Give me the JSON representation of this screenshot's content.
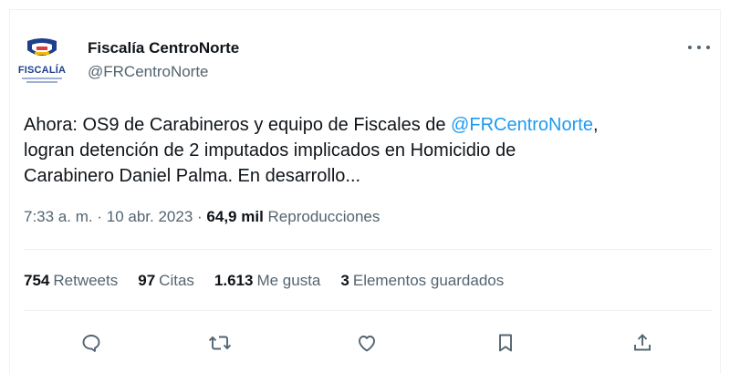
{
  "tweet": {
    "display_name": "Fiscalía CentroNorte",
    "handle": "@FRCentroNorte",
    "avatar_label": "FISCALÍA",
    "text_before": "Ahora: OS9 de Carabineros y equipo de Fiscales de ",
    "mention": "@FRCentroNorte",
    "text_after": ",",
    "text_line2": "logran detención de 2 imputados implicados en Homicidio de",
    "text_line3": "Carabinero Daniel Palma. En desarrollo...",
    "time": "7:33 a. m.",
    "sep1": "·",
    "date": "10 abr. 2023",
    "sep2": "·",
    "views_count": "64,9 mil",
    "views_label": "Reproducciones"
  },
  "stats": [
    {
      "count": "754",
      "label": "Retweets"
    },
    {
      "count": "97",
      "label": "Citas"
    },
    {
      "count": "1.613",
      "label": "Me gusta"
    },
    {
      "count": "3",
      "label": "Elementos guardados"
    }
  ],
  "icons": {
    "more": "more-dots-icon",
    "reply": "reply-icon",
    "retweet": "retweet-icon",
    "like": "heart-icon",
    "bookmark": "bookmark-icon",
    "share": "share-icon"
  },
  "colors": {
    "link": "#1d9bf0",
    "secondary_text": "#536471",
    "primary_text": "#0f1419",
    "brand": "#1f3f8c"
  }
}
